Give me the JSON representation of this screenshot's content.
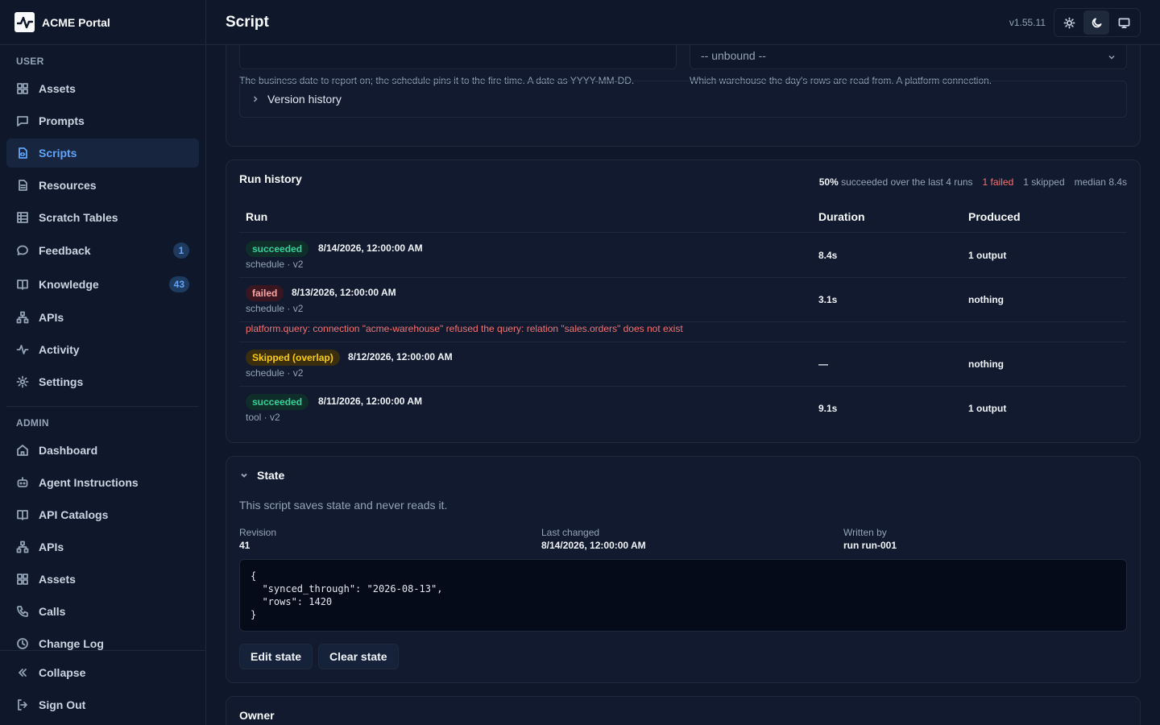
{
  "app": {
    "brand": "ACME Portal",
    "version": "v1.55.11"
  },
  "page": {
    "title": "Script"
  },
  "sidebar": {
    "user_label": "USER",
    "admin_label": "ADMIN",
    "user_items": [
      {
        "label": "Assets",
        "icon": "grid-icon"
      },
      {
        "label": "Prompts",
        "icon": "chat-icon"
      },
      {
        "label": "Scripts",
        "icon": "script-icon",
        "active": true
      },
      {
        "label": "Resources",
        "icon": "file-icon"
      },
      {
        "label": "Scratch Tables",
        "icon": "table-icon"
      },
      {
        "label": "Feedback",
        "icon": "message-icon",
        "badge": "1"
      },
      {
        "label": "Knowledge",
        "icon": "book-icon",
        "badge": "43"
      },
      {
        "label": "APIs",
        "icon": "network-icon"
      },
      {
        "label": "Activity",
        "icon": "activity-icon"
      },
      {
        "label": "Settings",
        "icon": "gear-icon"
      }
    ],
    "admin_items": [
      {
        "label": "Dashboard",
        "icon": "home-icon"
      },
      {
        "label": "Agent Instructions",
        "icon": "bot-icon"
      },
      {
        "label": "API Catalogs",
        "icon": "book-icon"
      },
      {
        "label": "APIs",
        "icon": "network-icon"
      },
      {
        "label": "Assets",
        "icon": "grid-icon"
      },
      {
        "label": "Calls",
        "icon": "phone-icon"
      },
      {
        "label": "Change Log",
        "icon": "clock-icon"
      }
    ],
    "collapse_label": "Collapse",
    "signout_label": "Sign Out"
  },
  "params": {
    "date_hint": "The business date to report on; the schedule pins it to the fire time. A date as YYYY-MM-DD.",
    "warehouse_value": "-- unbound --",
    "warehouse_hint": "Which warehouse the day's rows are read from. A platform connection.",
    "version_history_label": "Version history"
  },
  "run_history": {
    "title": "Run history",
    "stats": {
      "success_rate": "50%",
      "success_text": "succeeded over the last 4 runs",
      "failed": "1 failed",
      "skipped": "1 skipped",
      "median": "median 8.4s"
    },
    "columns": {
      "run": "Run",
      "duration": "Duration",
      "produced": "Produced"
    },
    "rows": [
      {
        "status": "succeeded",
        "date": "8/14/2026, 12:00:00 AM",
        "meta": "schedule · v2",
        "duration": "8.4s",
        "produced": "1 output"
      },
      {
        "status": "failed",
        "date": "8/13/2026, 12:00:00 AM",
        "meta": "schedule · v2",
        "duration": "3.1s",
        "produced": "nothing",
        "error": "platform.query: connection \"acme-warehouse\" refused the query: relation \"sales.orders\" does not exist"
      },
      {
        "status": "Skipped (overlap)",
        "date": "8/12/2026, 12:00:00 AM",
        "meta": "schedule · v2",
        "duration": "—",
        "produced": "nothing"
      },
      {
        "status": "succeeded",
        "date": "8/11/2026, 12:00:00 AM",
        "meta": "tool · v2",
        "duration": "9.1s",
        "produced": "1 output"
      }
    ]
  },
  "state": {
    "title": "State",
    "description": "This script saves state and never reads it.",
    "revision_label": "Revision",
    "revision_value": "41",
    "changed_label": "Last changed",
    "changed_value": "8/14/2026, 12:00:00 AM",
    "written_label": "Written by",
    "written_value": "run run-001",
    "json": "{\n  \"synced_through\": \"2026-08-13\",\n  \"rows\": 1420\n}",
    "edit_label": "Edit state",
    "clear_label": "Clear state"
  },
  "owner": {
    "title": "Owner"
  }
}
